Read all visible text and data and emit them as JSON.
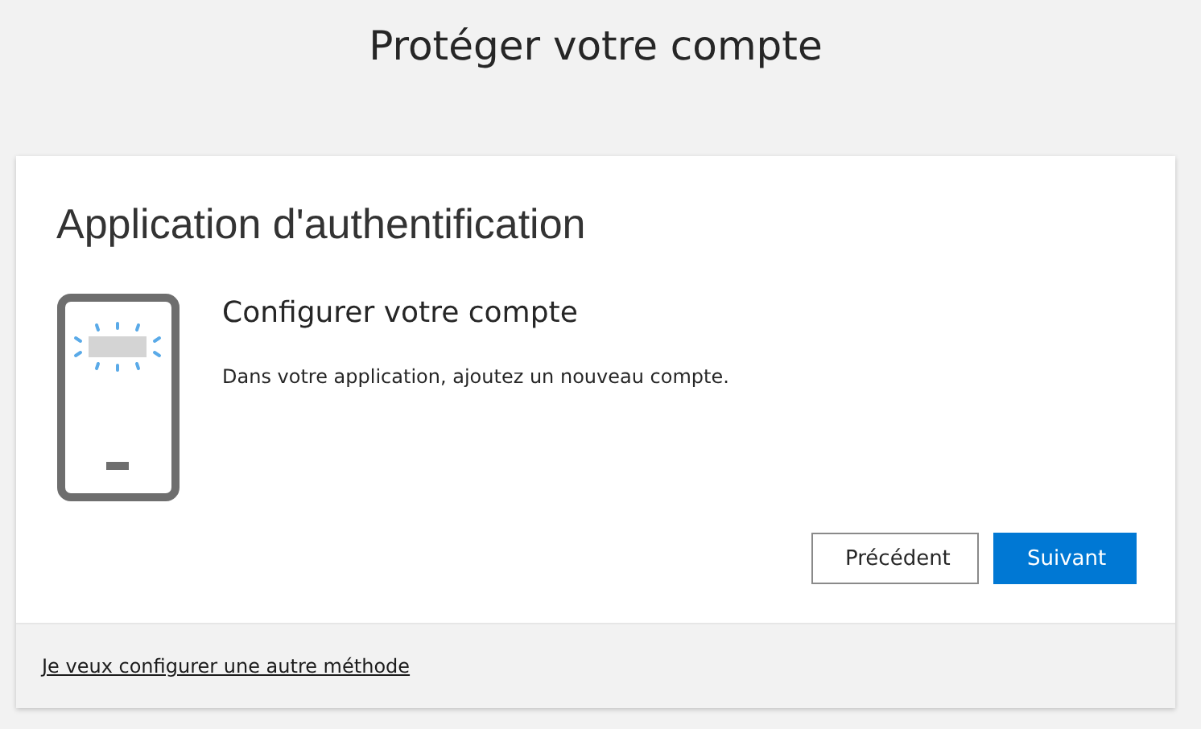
{
  "page_title": "Protéger votre compte",
  "card": {
    "title": "Application d'authentification",
    "step_title": "Configurer votre compte",
    "instruction": "Dans votre application, ajoutez un nouveau compte.",
    "buttons": [
      {
        "label": "Précédent",
        "kind": "secondary"
      },
      {
        "label": "Suivant",
        "kind": "primary"
      }
    ],
    "footer_link": "Je veux configurer une autre méthode"
  }
}
